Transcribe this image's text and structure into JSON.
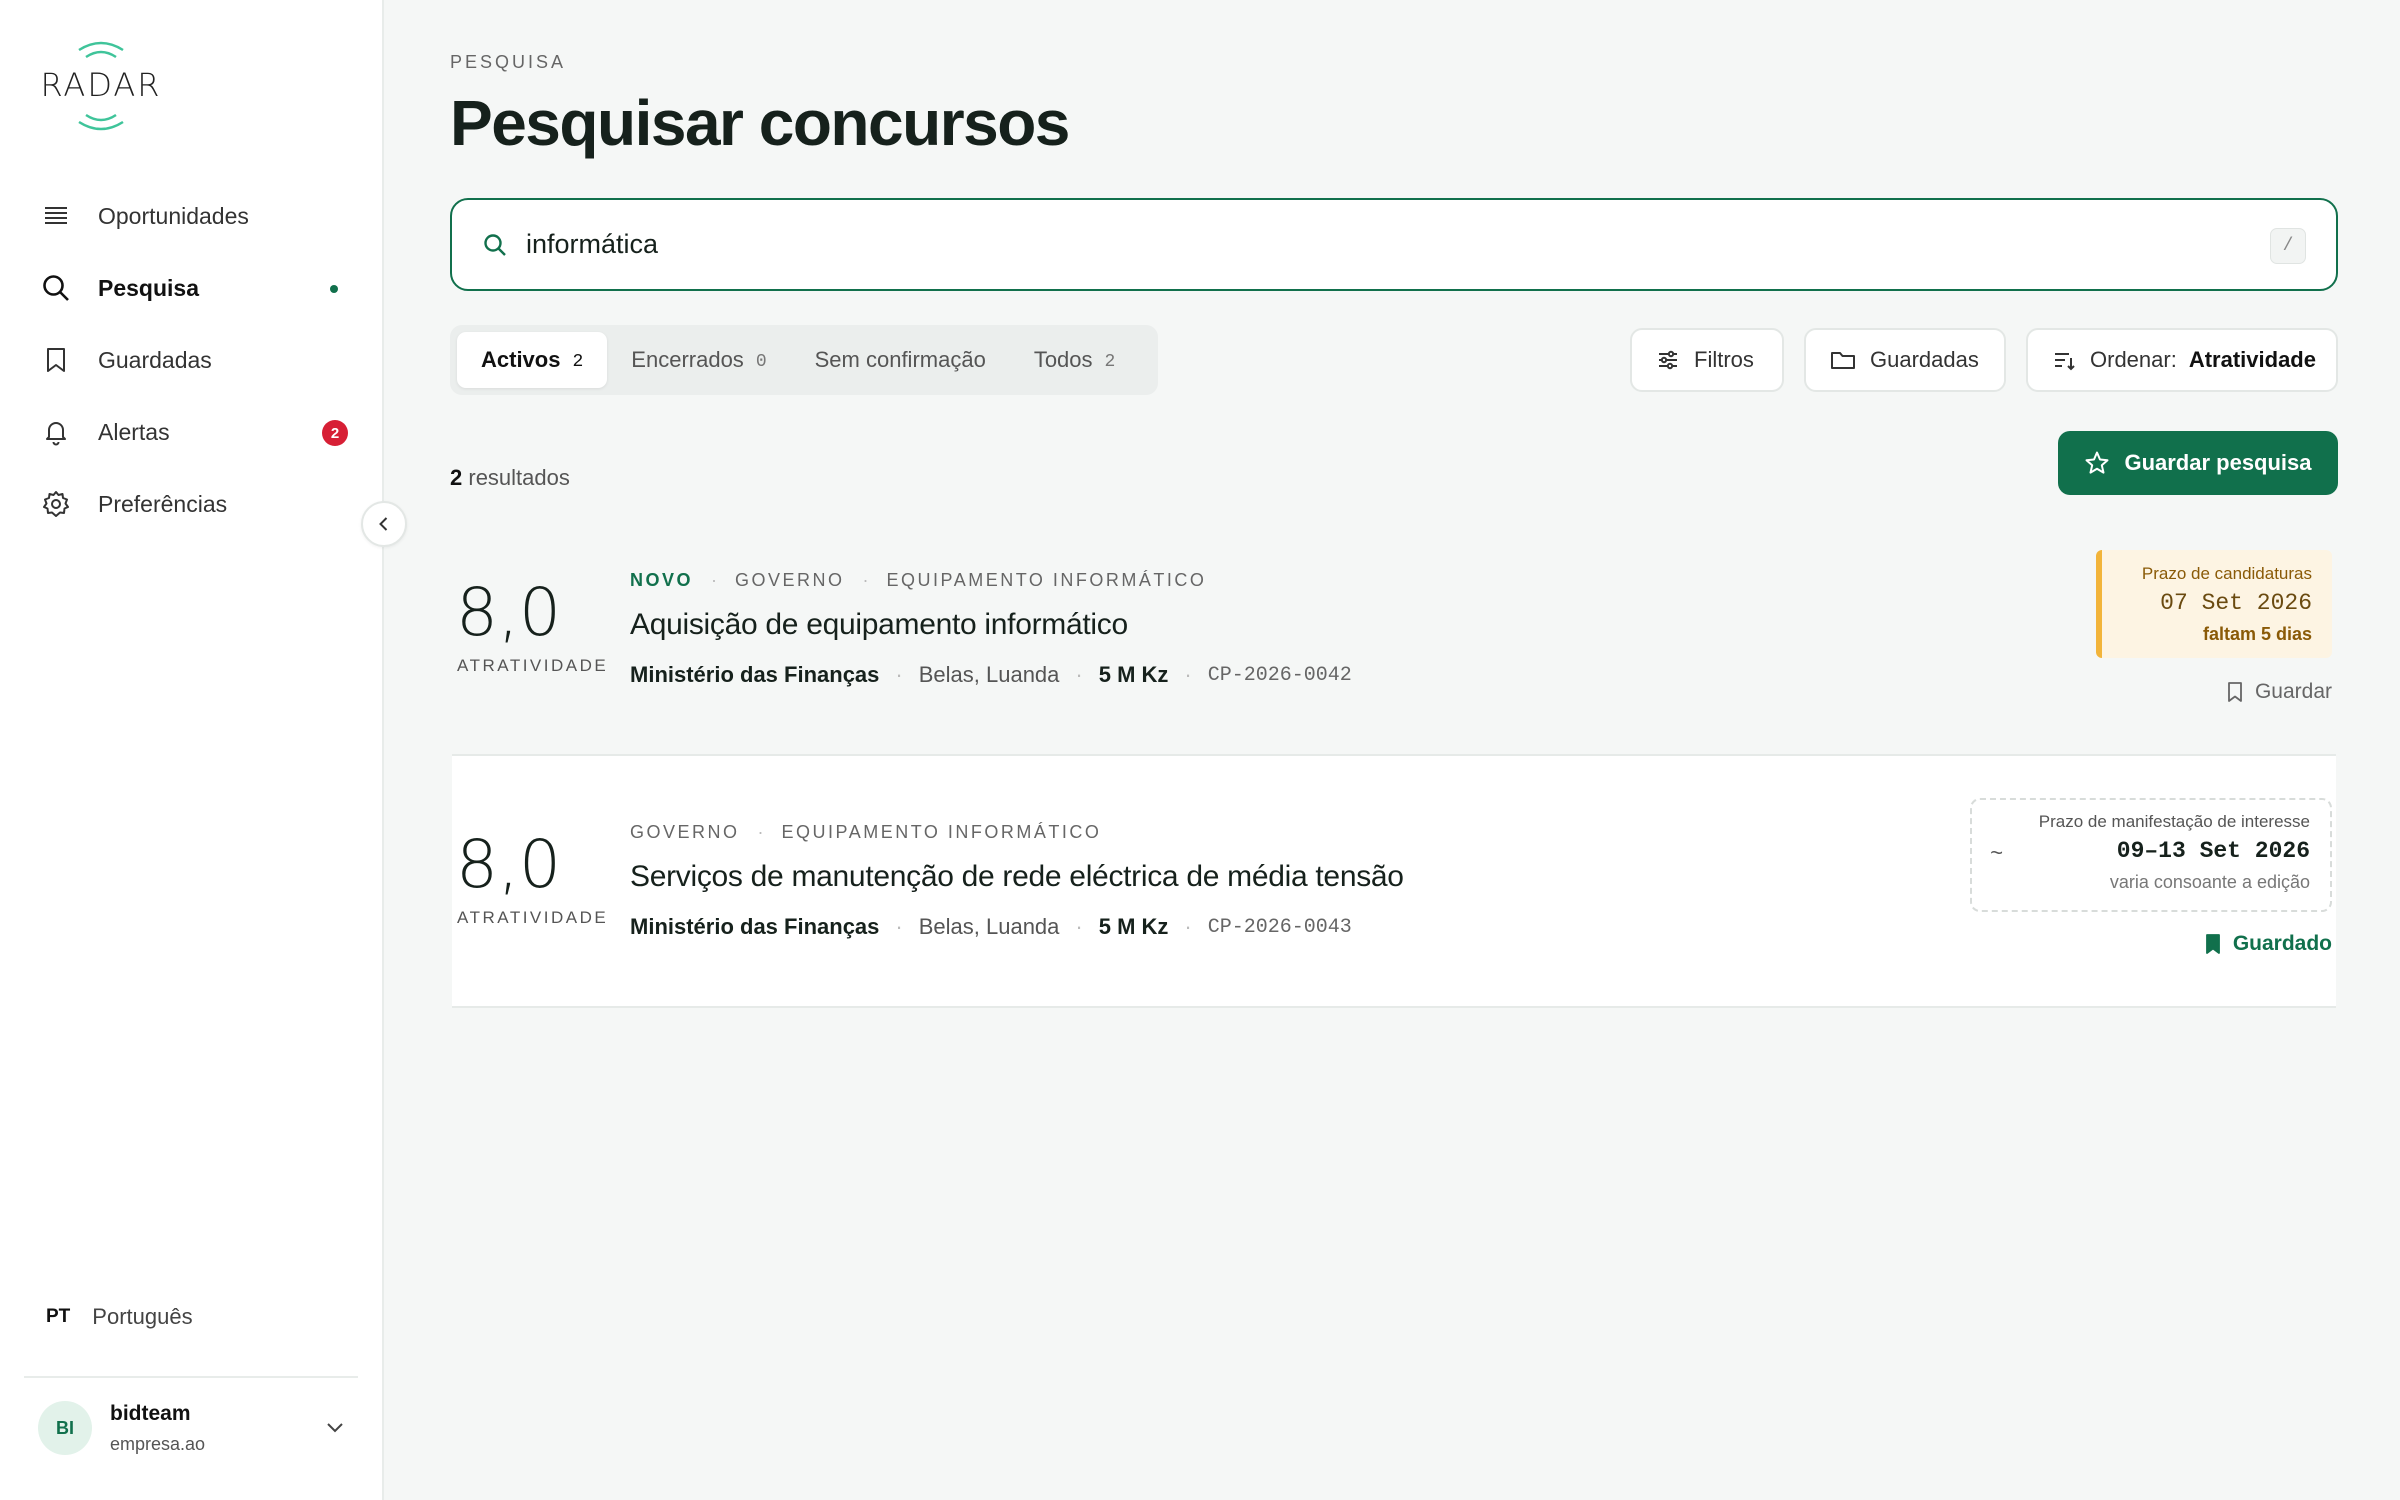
{
  "brand": {
    "logo_text": "RADAR"
  },
  "sidebar": {
    "items": [
      {
        "label": "Oportunidades",
        "icon": "list-icon"
      },
      {
        "label": "Pesquisa",
        "icon": "search-icon"
      },
      {
        "label": "Guardadas",
        "icon": "bookmark-icon"
      },
      {
        "label": "Alertas",
        "icon": "bell-icon",
        "badge": "2"
      },
      {
        "label": "Preferências",
        "icon": "gear-icon"
      }
    ],
    "language": {
      "code": "PT",
      "label": "Português"
    },
    "user": {
      "initials": "BI",
      "name": "bidteam",
      "org": "empresa.ao"
    }
  },
  "page": {
    "eyebrow": "PESQUISA",
    "title": "Pesquisar concursos"
  },
  "search": {
    "value": "informática",
    "shortcut": "/"
  },
  "tabs": [
    {
      "label": "Activos",
      "count": "2"
    },
    {
      "label": "Encerrados",
      "count": "0"
    },
    {
      "label": "Sem confirmação",
      "count": ""
    },
    {
      "label": "Todos",
      "count": "2"
    }
  ],
  "toolbar": {
    "filters_label": "Filtros",
    "saved_label": "Guardadas",
    "sort_prefix": "Ordenar:",
    "sort_value": "Atratividade"
  },
  "results": {
    "count": "2",
    "count_suffix": "resultados",
    "save_search_label": "Guardar pesquisa",
    "items": [
      {
        "score": "8,0",
        "score_label": "ATRATIVIDADE",
        "tag_new": "NOVO",
        "tags": [
          "GOVERNO",
          "EQUIPAMENTO INFORMÁTICO"
        ],
        "title": "Aquisição de equipamento informático",
        "org": "Ministério das Finanças",
        "location": "Belas, Luanda",
        "value": "5 M Kz",
        "ref": "CP-2026-0042",
        "deadline": {
          "label": "Prazo de candidaturas",
          "date": "07 Set 2026",
          "note": "faltam 5 dias"
        },
        "save_label": "Guardar"
      },
      {
        "score": "8,0",
        "score_label": "ATRATIVIDADE",
        "tags": [
          "GOVERNO",
          "EQUIPAMENTO INFORMÁTICO"
        ],
        "title": "Serviços de manutenção de rede eléctrica de média tensão",
        "org": "Ministério das Finanças",
        "location": "Belas, Luanda",
        "value": "5 M Kz",
        "ref": "CP-2026-0043",
        "deadline": {
          "label": "Prazo de manifestação de interesse",
          "prefix": "~",
          "date": "09–13 Set 2026",
          "note": "varia consoante a edição"
        },
        "save_label": "Guardado"
      }
    ]
  },
  "colors": {
    "accent": "#11704c",
    "badge": "#d71f35",
    "warning": "#f2b43a"
  }
}
